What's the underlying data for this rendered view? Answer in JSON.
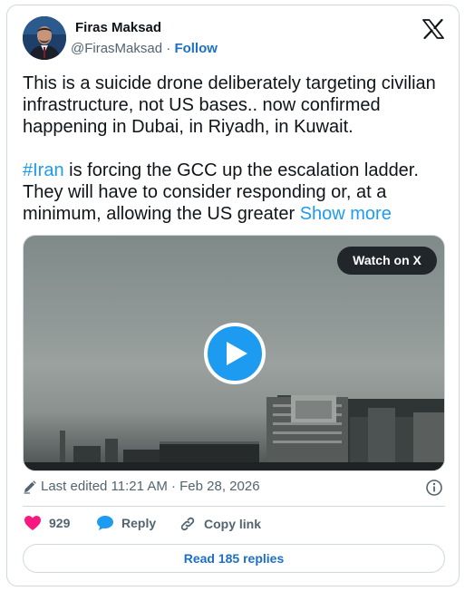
{
  "author": {
    "name": "Firas Maksad",
    "handle": "@FirasMaksad",
    "separator": "·",
    "follow_label": "Follow"
  },
  "tweet": {
    "paragraph1": "This is a suicide drone deliberately targeting civilian infrastructure, not US bases.. now confirmed happening in Dubai, in Riyadh, in Kuwait.",
    "hashtag": "#Iran",
    "paragraph2_rest": " is forcing the GCC up the escalation ladder. They will have to consider responding or, at a minimum, allowing the US greater ",
    "show_more": "Show more"
  },
  "media": {
    "watch_label": "Watch on X"
  },
  "meta": {
    "edited": "Last edited 11:21 AM · Feb 28, 2026"
  },
  "actions": {
    "like_count": "929",
    "reply_label": "Reply",
    "copy_label": "Copy link"
  },
  "replies_button": "Read 185 replies",
  "colors": {
    "accent": "#1d9bf0",
    "link": "#1d6fc4",
    "like": "#f91880",
    "secondary_text": "#536471",
    "border": "#cfd9de"
  }
}
